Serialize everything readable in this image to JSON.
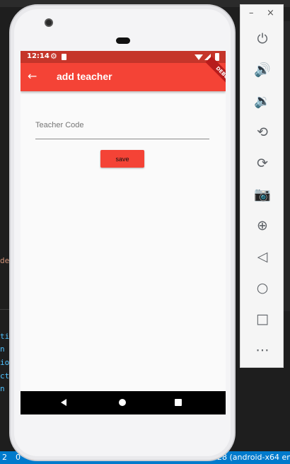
{
  "editor": {
    "fragments": [
      "de",
      "ti",
      "n",
      "io",
      "ct",
      "n"
    ],
    "status_left": "2",
    "status_left2": "0",
    "status_right": "28 (android-x64 em"
  },
  "phone": {
    "status_bar": {
      "time": "12:14"
    },
    "app_bar": {
      "title": "add teacher",
      "debug_banner": "DEBUG"
    },
    "form": {
      "teacher_code_label": "Teacher Code",
      "teacher_code_value": "",
      "save_label": "save"
    }
  },
  "emulator_toolbar": {
    "minimize": "–",
    "close": "×",
    "icons": [
      "power-icon",
      "volume-up-icon",
      "volume-down-icon",
      "rotate-left-icon",
      "rotate-right-icon",
      "camera-icon",
      "zoom-icon",
      "back-icon",
      "home-icon",
      "overview-icon",
      "more-icon"
    ]
  },
  "colors": {
    "app_bar": "#f44336",
    "status_bar": "#c5352a",
    "vscode_status": "#007acc"
  }
}
